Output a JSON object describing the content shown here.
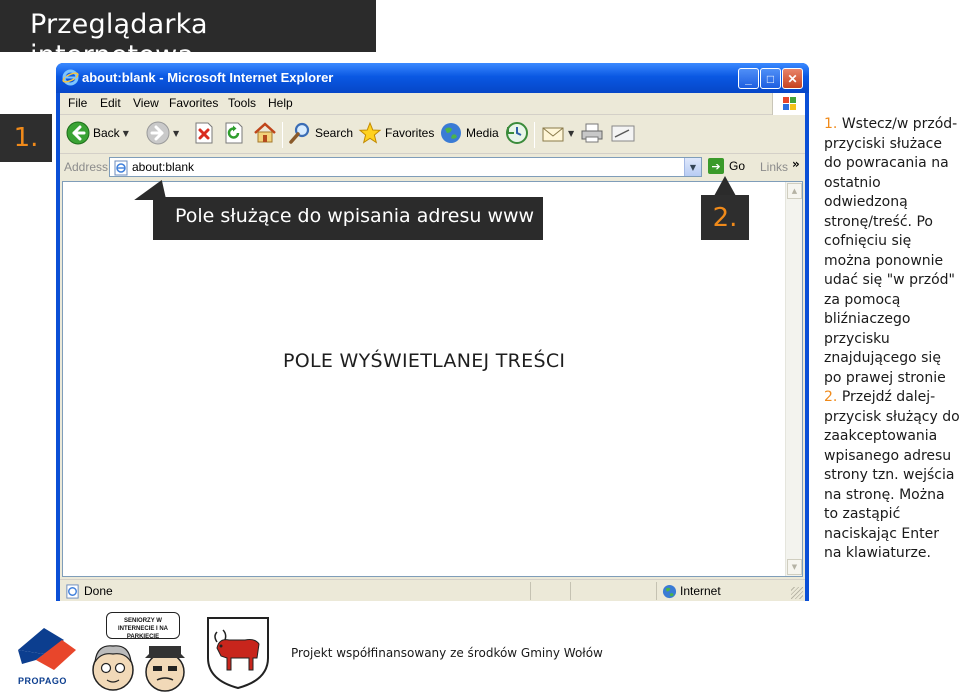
{
  "header": {
    "title": "Przeglądarka internetowa"
  },
  "steps": {
    "one": "1.",
    "two": "2."
  },
  "window": {
    "title": "about:blank - Microsoft Internet Explorer",
    "controls": {
      "minimize": "_",
      "maximize": "□",
      "close": "✕"
    }
  },
  "menu": [
    "File",
    "Edit",
    "View",
    "Favorites",
    "Tools",
    "Help"
  ],
  "toolbar": {
    "back": "Back",
    "search": "Search",
    "favorites": "Favorites",
    "media": "Media"
  },
  "address": {
    "label": "Address",
    "value": "about:blank",
    "go": "Go",
    "links": "Links",
    "chevron": "»"
  },
  "content": {
    "text": "POLE WYŚWIETLANEJ TREŚCI"
  },
  "status": {
    "text": "Done",
    "zone": "Internet"
  },
  "callout": {
    "text": "Pole służące do wpisania adresu www"
  },
  "explanation": {
    "n1": "1.",
    "part1": "Wstecz/w przód- przyciski służace do powracania na ostatnio odwiedzoną stronę/treść. Po cofnięciu się można ponownie udać się \"w przód\" za pomocą bliźniaczego przycisku znajdującego się po prawej stronie",
    "n2": "2.",
    "part2": "Przejdź dalej-przycisk służący do zaakceptowania wpisanego adresu strony tzn. wejścia na stronę. Można to zastąpić naciskając Enter na klawiaturze."
  },
  "footer": {
    "text": "Projekt współfinansowany ze środków Gminy Wołów",
    "propago": "PROPAGO",
    "seniors_bubble": "SENIORZY W INTERNECIE I NA PARKIECIE"
  },
  "colors": {
    "accent": "#f08a1a",
    "dark": "#2b2b2b",
    "xp_blue": "#0a58e3",
    "xp_face": "#ece9d8"
  }
}
